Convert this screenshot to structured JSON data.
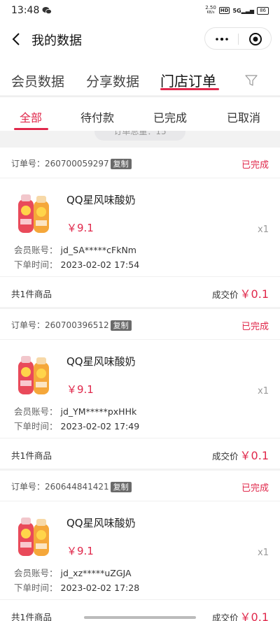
{
  "status_bar": {
    "time": "13:48",
    "net_speed_value": "2.50",
    "net_speed_unit": "KB/s",
    "hd": "HD",
    "signal": "5G",
    "battery": "86"
  },
  "nav": {
    "title": "我的数据"
  },
  "main_tabs": [
    {
      "label": "会员数据",
      "active": false
    },
    {
      "label": "分享数据",
      "active": false
    },
    {
      "label": "门店订单",
      "active": true
    }
  ],
  "status_tabs": [
    {
      "label": "全部",
      "active": true
    },
    {
      "label": "待付款",
      "active": false
    },
    {
      "label": "已完成",
      "active": false
    },
    {
      "label": "已取消",
      "active": false
    }
  ],
  "total_label": "订单总量：15",
  "labels": {
    "order_no": "订单号：",
    "copy": "复制",
    "member_account": "会员账号：",
    "order_time": "下单时间：",
    "deal_price": "成交价"
  },
  "orders": [
    {
      "order_no": "260700059297",
      "status": "已完成",
      "product_name": "QQ星风味酸奶",
      "price": "￥9.1",
      "qty": "x1",
      "member_account": "jd_SA*****cFkNm",
      "order_time": "2023-02-02 17:54",
      "item_count": "共1件商品",
      "deal_price": "￥0.1"
    },
    {
      "order_no": "260700396512",
      "status": "已完成",
      "product_name": "QQ星风味酸奶",
      "price": "￥9.1",
      "qty": "x1",
      "member_account": "jd_YM*****pxHHk",
      "order_time": "2023-02-02 17:49",
      "item_count": "共1件商品",
      "deal_price": "￥0.1"
    },
    {
      "order_no": "260644841421",
      "status": "已完成",
      "product_name": "QQ星风味酸奶",
      "price": "￥9.1",
      "qty": "x1",
      "member_account": "jd_xz*****uZGJA",
      "order_time": "2023-02-02 17:28",
      "item_count": "共1件商品",
      "deal_price": "￥0.1"
    }
  ],
  "colors": {
    "accent": "#e0284b",
    "background": "#f2f2f2",
    "copy_badge": "#6a6a6a"
  }
}
